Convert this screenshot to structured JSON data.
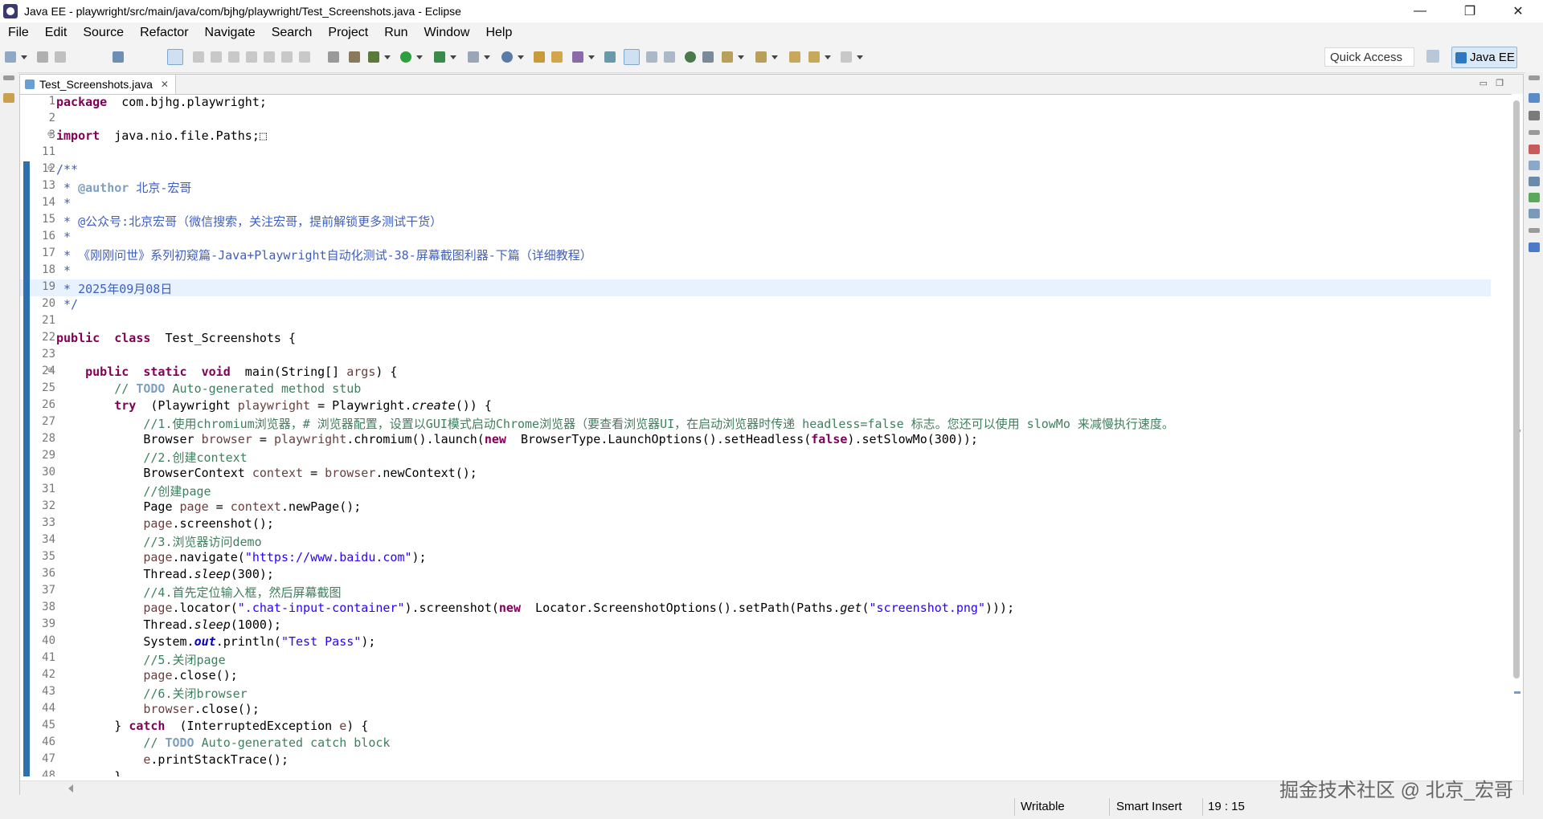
{
  "window": {
    "title": "Java EE - playwright/src/main/java/com/bjhg/playwright/Test_Screenshots.java - Eclipse",
    "controls": [
      "—",
      "❐",
      "✕"
    ]
  },
  "menu": [
    "File",
    "Edit",
    "Source",
    "Refactor",
    "Navigate",
    "Search",
    "Project",
    "Run",
    "Window",
    "Help"
  ],
  "toolbar": {
    "quick_access": "Quick Access",
    "perspective": "Java EE"
  },
  "editor": {
    "tab_label": "Test_Screenshots.java",
    "tab_close": "✕",
    "minimize": "▭",
    "maximize": "❐",
    "current_line": "19"
  },
  "code": [
    {
      "n": "1",
      "t": [
        [
          "kw",
          "package"
        ],
        [
          "",
          "  com.bjhg.playwright;"
        ]
      ]
    },
    {
      "n": "2",
      "t": []
    },
    {
      "n": "3",
      "fold": "⊕",
      "t": [
        [
          "kw",
          "import"
        ],
        [
          "",
          "  java.nio.file.Paths;"
        ],
        [
          "",
          "⬚"
        ]
      ]
    },
    {
      "n": "11",
      "t": []
    },
    {
      "n": "12",
      "fold": "⊖",
      "t": [
        [
          "jd",
          "/**"
        ]
      ]
    },
    {
      "n": "13",
      "t": [
        [
          "jd",
          " * "
        ],
        [
          "tag",
          "@author"
        ],
        [
          "jd",
          " 北京-宏哥"
        ]
      ]
    },
    {
      "n": "14",
      "t": [
        [
          "jd",
          " *"
        ]
      ]
    },
    {
      "n": "15",
      "t": [
        [
          "jd",
          " * @公众号:北京宏哥（微信搜索，关注宏哥，提前解锁更多测试干货）"
        ]
      ]
    },
    {
      "n": "16",
      "t": [
        [
          "jd",
          " *"
        ]
      ]
    },
    {
      "n": "17",
      "t": [
        [
          "jd",
          " * 《刚刚问世》系列初窥篇-Java+Playwright自动化测试-38-屏幕截图利器-下篇（详细教程）"
        ]
      ]
    },
    {
      "n": "18",
      "t": [
        [
          "jd",
          " *"
        ]
      ]
    },
    {
      "n": "19",
      "t": [
        [
          "jd",
          " * 2025年09月08日"
        ]
      ]
    },
    {
      "n": "20",
      "t": [
        [
          "jd",
          " */"
        ]
      ]
    },
    {
      "n": "21",
      "t": []
    },
    {
      "n": "22",
      "t": [
        [
          "kw",
          "public"
        ],
        [
          "",
          "  "
        ],
        [
          "kw",
          "class"
        ],
        [
          "",
          "  Test_Screenshots {"
        ]
      ]
    },
    {
      "n": "23",
      "t": []
    },
    {
      "n": "24",
      "fold": "⊖",
      "t": [
        [
          "",
          "    "
        ],
        [
          "kw",
          "public"
        ],
        [
          "",
          "  "
        ],
        [
          "kw",
          "static"
        ],
        [
          "",
          "  "
        ],
        [
          "kw",
          "void"
        ],
        [
          "",
          "  main(String[] "
        ],
        [
          "var",
          "args"
        ],
        [
          "",
          ") {"
        ]
      ]
    },
    {
      "n": "25",
      "t": [
        [
          "cm",
          "        // "
        ],
        [
          "todo",
          "TODO"
        ],
        [
          "cm",
          " Auto-generated method stub"
        ]
      ]
    },
    {
      "n": "26",
      "t": [
        [
          "",
          "        "
        ],
        [
          "kw",
          "try"
        ],
        [
          "",
          "  (Playwright "
        ],
        [
          "var",
          "playwright"
        ],
        [
          "",
          " = Playwright."
        ],
        [
          "it",
          "create"
        ],
        [
          "",
          "()) {"
        ]
      ]
    },
    {
      "n": "27",
      "t": [
        [
          "cm",
          "            //1.使用chromium浏览器，# 浏览器配置，设置以GUI模式启动Chrome浏览器（要查看浏览器UI，在启动浏览器时传递 headless=false 标志。您还可以使用 slowMo 来减慢执行速度。"
        ]
      ]
    },
    {
      "n": "28",
      "t": [
        [
          "",
          "            Browser "
        ],
        [
          "var",
          "browser"
        ],
        [
          "",
          " = "
        ],
        [
          "var",
          "playwright"
        ],
        [
          "",
          ".chromium().launch("
        ],
        [
          "kw",
          "new"
        ],
        [
          "",
          "  BrowserType.LaunchOptions().setHeadless("
        ],
        [
          "kw",
          "false"
        ],
        [
          "",
          ").setSlowMo(300));"
        ]
      ]
    },
    {
      "n": "29",
      "t": [
        [
          "cm",
          "            //2.创建context"
        ]
      ]
    },
    {
      "n": "30",
      "t": [
        [
          "",
          "            BrowserContext "
        ],
        [
          "var",
          "context"
        ],
        [
          "",
          " = "
        ],
        [
          "var",
          "browser"
        ],
        [
          "",
          ".newContext();"
        ]
      ]
    },
    {
      "n": "31",
      "t": [
        [
          "cm",
          "            //创建page"
        ]
      ]
    },
    {
      "n": "32",
      "t": [
        [
          "",
          "            Page "
        ],
        [
          "var",
          "page"
        ],
        [
          "",
          " = "
        ],
        [
          "var",
          "context"
        ],
        [
          "",
          ".newPage();"
        ]
      ]
    },
    {
      "n": "33",
      "t": [
        [
          "var",
          "            page"
        ],
        [
          "",
          ".screenshot();"
        ]
      ]
    },
    {
      "n": "34",
      "t": [
        [
          "cm",
          "            //3.浏览器访问demo"
        ]
      ]
    },
    {
      "n": "35",
      "t": [
        [
          "var",
          "            page"
        ],
        [
          "",
          ".navigate("
        ],
        [
          "st",
          "\"https://www.baidu.com\""
        ],
        [
          "",
          ");"
        ]
      ]
    },
    {
      "n": "36",
      "t": [
        [
          "",
          "            Thread."
        ],
        [
          "it",
          "sleep"
        ],
        [
          "",
          "(300);"
        ]
      ]
    },
    {
      "n": "37",
      "t": [
        [
          "cm",
          "            //4.首先定位输入框，然后屏幕截图"
        ]
      ]
    },
    {
      "n": "38",
      "t": [
        [
          "var",
          "            page"
        ],
        [
          "",
          ".locator("
        ],
        [
          "st",
          "\".chat-input-container\""
        ],
        [
          "",
          ").screenshot("
        ],
        [
          "kw",
          "new"
        ],
        [
          "",
          "  Locator.ScreenshotOptions().setPath(Paths."
        ],
        [
          "it",
          "get"
        ],
        [
          "",
          "("
        ],
        [
          "st",
          "\"screenshot.png\""
        ],
        [
          "",
          ")));"
        ]
      ]
    },
    {
      "n": "39",
      "t": [
        [
          "",
          "            Thread."
        ],
        [
          "it",
          "sleep"
        ],
        [
          "",
          "(1000);"
        ]
      ]
    },
    {
      "n": "40",
      "t": [
        [
          "",
          "            System."
        ],
        [
          "field",
          "out"
        ],
        [
          "",
          ".println("
        ],
        [
          "st",
          "\"Test Pass\""
        ],
        [
          "",
          ");"
        ]
      ]
    },
    {
      "n": "41",
      "t": [
        [
          "cm",
          "            //5.关闭page"
        ]
      ]
    },
    {
      "n": "42",
      "t": [
        [
          "var",
          "            page"
        ],
        [
          "",
          ".close();"
        ]
      ]
    },
    {
      "n": "43",
      "t": [
        [
          "cm",
          "            //6.关闭browser"
        ]
      ]
    },
    {
      "n": "44",
      "t": [
        [
          "var",
          "            browser"
        ],
        [
          "",
          ".close();"
        ]
      ]
    },
    {
      "n": "45",
      "t": [
        [
          "",
          "        } "
        ],
        [
          "kw",
          "catch"
        ],
        [
          "",
          "  (InterruptedException "
        ],
        [
          "var",
          "e"
        ],
        [
          "",
          ") {"
        ]
      ]
    },
    {
      "n": "46",
      "t": [
        [
          "cm",
          "            // "
        ],
        [
          "todo",
          "TODO"
        ],
        [
          "cm",
          " Auto-generated catch block"
        ]
      ]
    },
    {
      "n": "47",
      "t": [
        [
          "var",
          "            e"
        ],
        [
          "",
          ".printStackTrace();"
        ]
      ]
    },
    {
      "n": "48",
      "t": [
        [
          "",
          "        }"
        ]
      ]
    }
  ],
  "status": {
    "writable": "Writable",
    "insert_mode": "Smart Insert",
    "position": "19 : 15"
  },
  "watermark": "掘金技术社区 @ 北京_宏哥"
}
